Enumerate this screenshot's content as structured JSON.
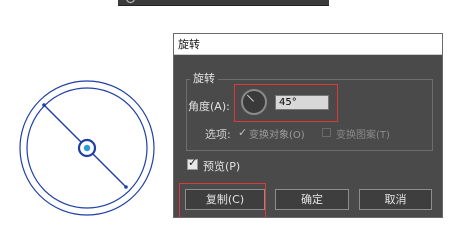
{
  "dialog": {
    "title": "旋转",
    "group_title": "旋转",
    "angle_label": "角度(A):",
    "angle_value": "45°",
    "options_label": "选项:",
    "option_transform_objects": {
      "label": "变换对象(O)",
      "checked": true
    },
    "option_transform_patterns": {
      "label": "变换图案(T)",
      "checked": false
    },
    "preview": {
      "label": "预览(P)",
      "checked": true
    },
    "buttons": {
      "copy": "复制(C)",
      "ok": "确定",
      "cancel": "取消"
    }
  },
  "colors": {
    "artwork_stroke": "#1f3fa6",
    "center_fill": "#2a9ad8",
    "highlight": "#d93a3a",
    "dialog_bg": "#4a4a4a"
  },
  "icons": {
    "check": "✓"
  }
}
